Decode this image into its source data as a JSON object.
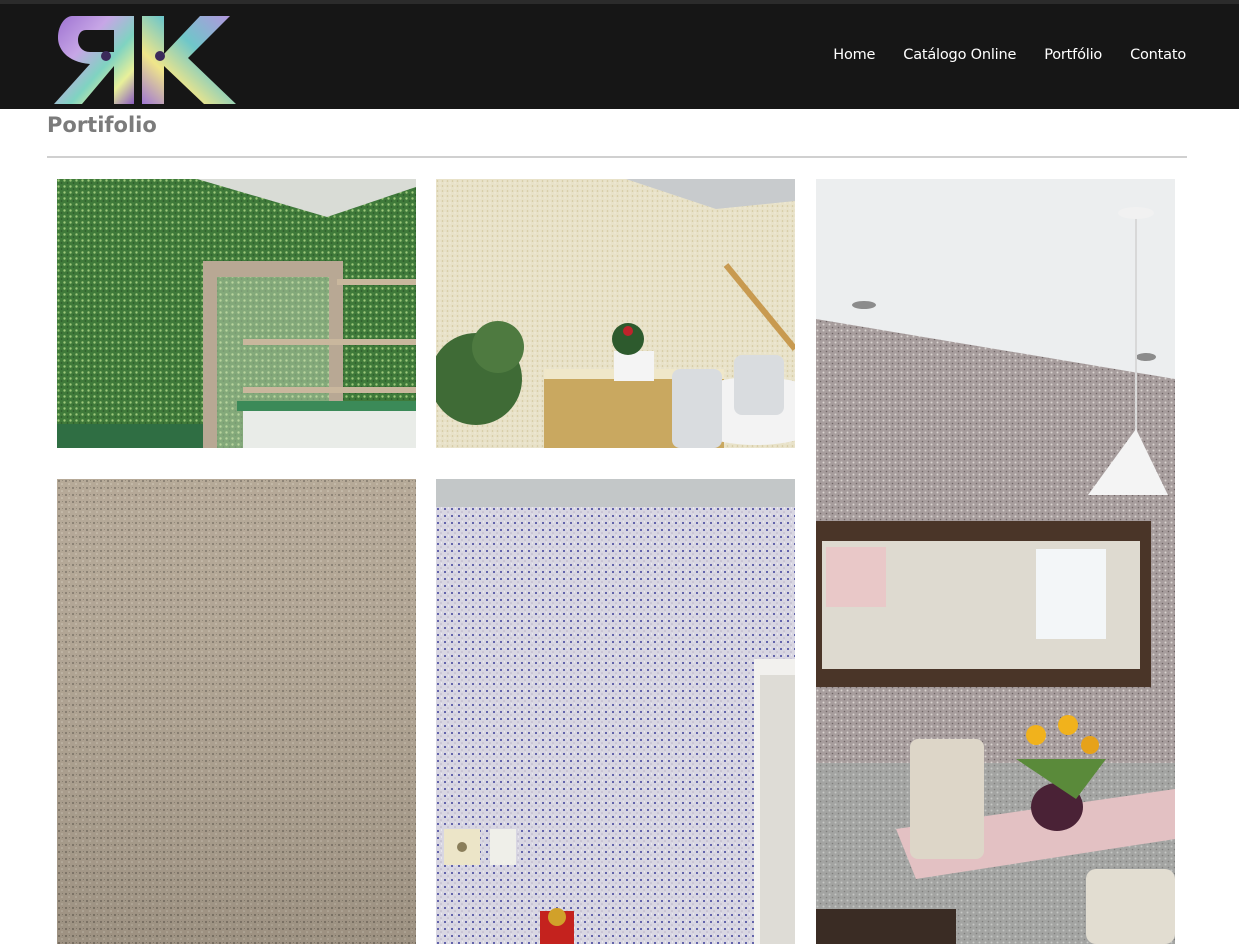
{
  "header": {
    "logo_text": "RK",
    "nav": [
      {
        "label": "Home"
      },
      {
        "label": "Catálogo Online"
      },
      {
        "label": "Portfólio"
      },
      {
        "label": "Contato"
      }
    ]
  },
  "main": {
    "title": "Portifolio"
  },
  "gallery": {
    "items": [
      {
        "subject": "green-textured-wall-bathroom"
      },
      {
        "subject": "cream-textured-wall-dining"
      },
      {
        "subject": "gray-textured-wall-dining-mirror"
      },
      {
        "subject": "beige-textured-wall-closeup"
      },
      {
        "subject": "blue-speckled-textured-wall"
      }
    ]
  }
}
